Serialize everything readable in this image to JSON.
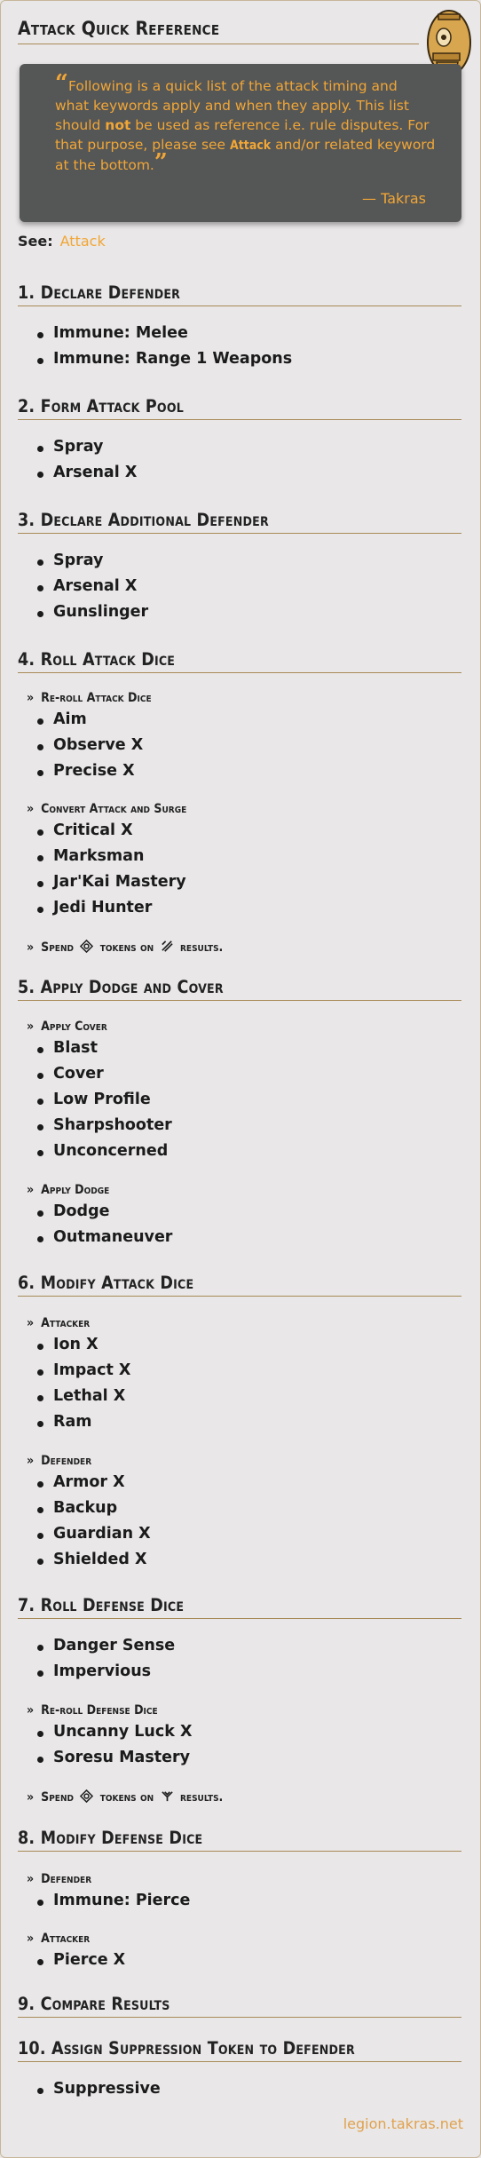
{
  "page": {
    "title": "Attack Quick Reference",
    "see_label": "See:",
    "see_link": "Attack",
    "footer": "legion.takras.net"
  },
  "quote": {
    "line1": "Following is a quick list of the attack timing and",
    "line2": "what keywords apply and when they apply. This list",
    "line3_pre": "should ",
    "line3_bold": "not",
    "line3_post": " be used as reference i.e. rule disputes. For",
    "line4_pre": "that purpose, please see ",
    "line4_kw": "Attack",
    "line4_post": " and/or related keyword",
    "line5": "at the bottom.",
    "author": "— Takras"
  },
  "sections": {
    "s1": {
      "title": "1. Declare Defender",
      "items": [
        "Immune: Melee",
        "Immune: Range 1 Weapons"
      ]
    },
    "s2": {
      "title": "2. Form Attack Pool",
      "items": [
        "Spray",
        "Arsenal X"
      ]
    },
    "s3": {
      "title": "3. Declare Additional Defender",
      "items": [
        "Spray",
        "Arsenal X",
        "Gunslinger"
      ]
    },
    "s4": {
      "title": "4. Roll Attack Dice",
      "sub1": "Re-roll Attack Dice",
      "sub1_items": [
        "Aim",
        "Observe X",
        "Precise X"
      ],
      "sub2": "Convert Attack and Surge",
      "sub2_items": [
        "Critical X",
        "Marksman",
        "Jar'Kai Mastery",
        "Jedi Hunter"
      ],
      "sub3_pre": "Spend",
      "sub3_mid": "tokens on",
      "sub3_post": "results."
    },
    "s5": {
      "title": "5. Apply Dodge and Cover",
      "sub1": "Apply Cover",
      "sub1_items": [
        "Blast",
        "Cover",
        "Low Profile",
        "Sharpshooter",
        "Unconcerned"
      ],
      "sub2": "Apply Dodge",
      "sub2_items": [
        "Dodge",
        "Outmaneuver"
      ]
    },
    "s6": {
      "title": "6. Modify Attack Dice",
      "sub1": "Attacker",
      "sub1_items": [
        "Ion X",
        "Impact X",
        "Lethal X",
        "Ram"
      ],
      "sub2": "Defender",
      "sub2_items": [
        "Armor X",
        "Backup",
        "Guardian X",
        "Shielded X"
      ]
    },
    "s7": {
      "title": "7. Roll Defense Dice",
      "items": [
        "Danger Sense",
        "Impervious"
      ],
      "sub1": "Re-roll Defense Dice",
      "sub1_items": [
        "Uncanny Luck X",
        "Soresu Mastery"
      ],
      "sub2_pre": "Spend",
      "sub2_mid": "tokens on",
      "sub2_post": "results."
    },
    "s8": {
      "title": "8. Modify Defense Dice",
      "sub1": "Defender",
      "sub1_items": [
        "Immune: Pierce"
      ],
      "sub2": "Attacker",
      "sub2_items": [
        "Pierce X"
      ]
    },
    "s9": {
      "title": "9. Compare Results"
    },
    "s10": {
      "title": "10. Assign Suppression Token to Defender",
      "items": [
        "Suppressive"
      ]
    }
  },
  "colors": {
    "accent": "#f1a636",
    "rule": "#a88a58",
    "quote_bg": "#555656",
    "page_bg": "#e9e7e7"
  },
  "icons": {
    "avatar": "droid-avatar-icon",
    "sub_marker": "double-chevron-right-icon",
    "token": "token-icon",
    "hit_symbol": "crit-hit-symbol-icon",
    "block_symbol": "block-symbol-icon"
  }
}
